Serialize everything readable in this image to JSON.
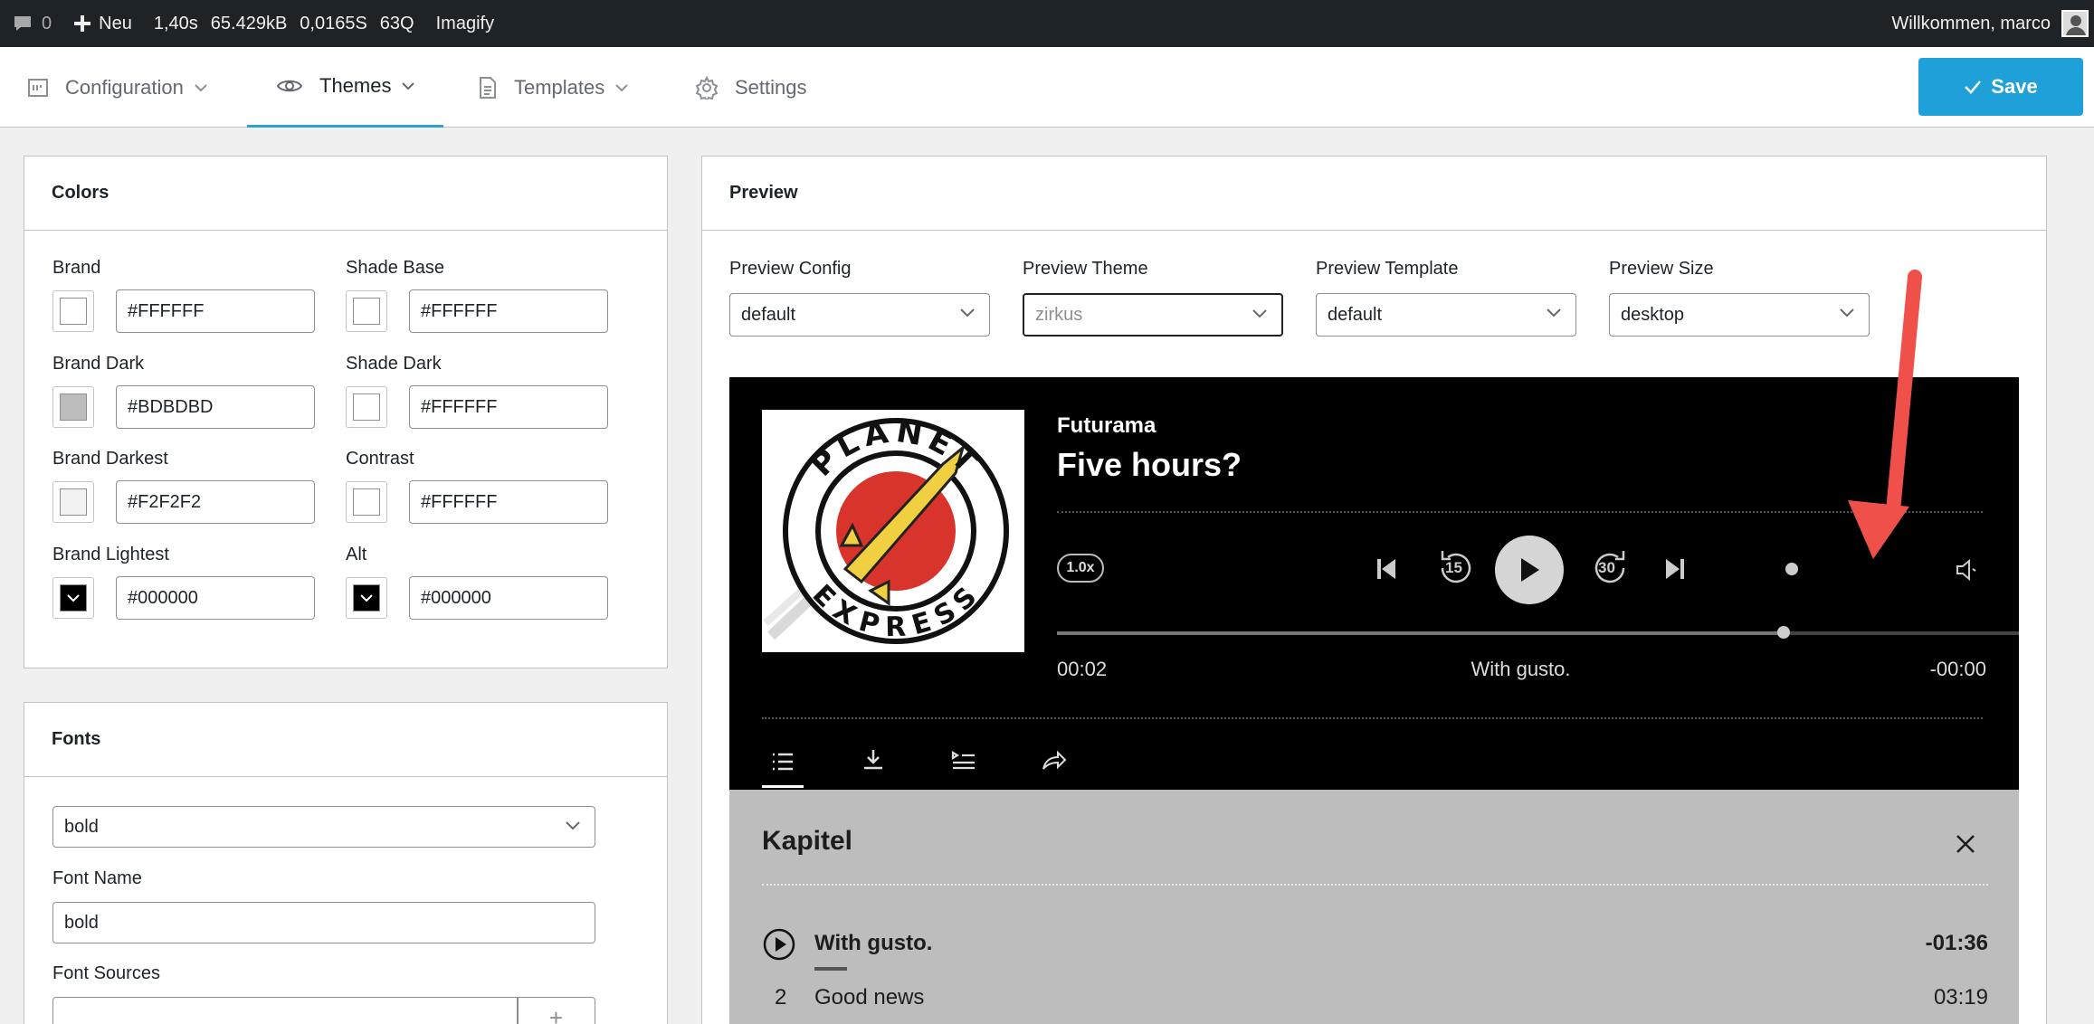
{
  "admin_bar": {
    "comments_count": "0",
    "new_label": "Neu",
    "stat_time": "1,40s",
    "stat_mem": "65.429kB",
    "stat_qtime": "0,0165S",
    "stat_queries": "63Q",
    "imagify": "Imagify",
    "welcome": "Willkommen, marco"
  },
  "tabs": [
    {
      "label": "Configuration",
      "icon": "config-icon",
      "active": false
    },
    {
      "label": "Themes",
      "icon": "eye-icon",
      "active": true
    },
    {
      "label": "Templates",
      "icon": "document-icon",
      "active": false
    },
    {
      "label": "Settings",
      "icon": "gear-icon",
      "active": false
    }
  ],
  "save_label": "Save",
  "colors_panel": {
    "title": "Colors",
    "fields": [
      {
        "label": "Brand",
        "value": "#FFFFFF",
        "swatch": "#FFFFFF"
      },
      {
        "label": "Shade Base",
        "value": "#FFFFFF",
        "swatch": "#FFFFFF"
      },
      {
        "label": "Brand Dark",
        "value": "#BDBDBD",
        "swatch": "#BDBDBD"
      },
      {
        "label": "Shade Dark",
        "value": "#FFFFFF",
        "swatch": "#FFFFFF"
      },
      {
        "label": "Brand Darkest",
        "value": "#F2F2F2",
        "swatch": "#F2F2F2"
      },
      {
        "label": "Contrast",
        "value": "#FFFFFF",
        "swatch": "#FFFFFF"
      },
      {
        "label": "Brand Lightest",
        "value": "#000000",
        "swatch": "#000000"
      },
      {
        "label": "Alt",
        "value": "#000000",
        "swatch": "#000000"
      }
    ]
  },
  "fonts_panel": {
    "title": "Fonts",
    "font_select": "bold",
    "font_name_label": "Font Name",
    "font_name_value": "bold",
    "font_sources_label": "Font Sources",
    "add_label": "+"
  },
  "preview_panel": {
    "title": "Preview",
    "config_label": "Preview Config",
    "config_value": "default",
    "theme_label": "Preview Theme",
    "theme_value": "zirkus",
    "template_label": "Preview Template",
    "template_value": "default",
    "size_label": "Preview Size",
    "size_value": "desktop"
  },
  "player": {
    "show": "Futurama",
    "episode": "Five hours?",
    "speed": "1.0x",
    "skip_back": "15",
    "skip_forward": "30",
    "progress": 0.755,
    "time_current": "00:02",
    "chapter_now": "With gusto.",
    "time_remaining": "-00:00",
    "cover_top_text": "PLANET",
    "cover_bottom_text": "EXPRESS"
  },
  "chapters": {
    "title": "Kapitel",
    "items": [
      {
        "num": "",
        "title": "With gusto.",
        "time": "-01:36",
        "active": true
      },
      {
        "num": "2",
        "title": "Good news",
        "time": "03:19",
        "active": false
      }
    ]
  },
  "colors": {
    "accent": "#1fa0d8",
    "tab_underline": "#2ea2cc",
    "annotation_arrow": "#f0504a"
  }
}
